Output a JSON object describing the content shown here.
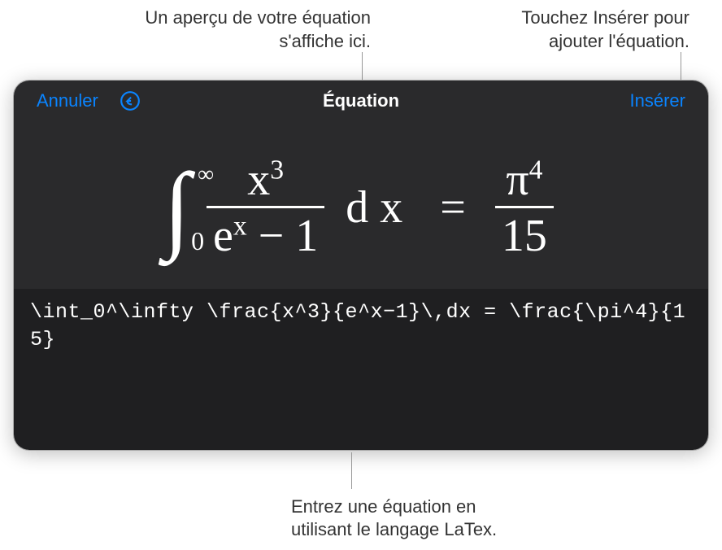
{
  "callouts": {
    "preview": "Un aperçu de votre équation s'affiche ici.",
    "insert": "Touchez Insérer pour ajouter l'équation.",
    "input": "Entrez une équation en utilisant le langage LaTex."
  },
  "toolbar": {
    "cancel_label": "Annuler",
    "title": "Équation",
    "insert_label": "Insérer"
  },
  "equation": {
    "latex_source": "\\int_0^\\infty \\frac{x^3}{e^x−1}\\,dx = \\frac{\\pi^4}{15}",
    "integral_sign": "∫",
    "integral_lower": "0",
    "integral_upper": "∞",
    "frac1_num": "x",
    "frac1_num_sup": "3",
    "frac1_den_base": "e",
    "frac1_den_sup": "x",
    "frac1_den_tail": " − 1",
    "dx": "d x",
    "equals": "=",
    "frac2_num_base": "π",
    "frac2_num_sup": "4",
    "frac2_den": "15"
  },
  "colors": {
    "accent": "#0a84ff",
    "panel_top": "#2a2a2c",
    "panel_bottom": "#1f1f21"
  }
}
